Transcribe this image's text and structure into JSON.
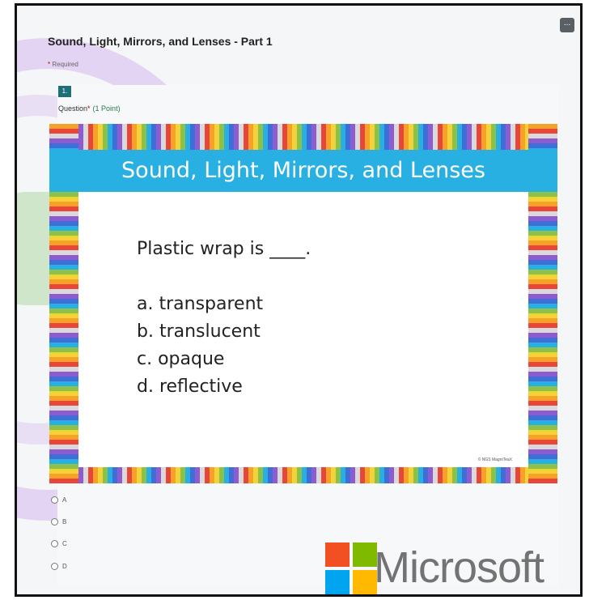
{
  "form": {
    "title": "Sound, Light, Mirrors, and Lenses - Part 1",
    "required_star": "*",
    "required_note": "Required",
    "more_icon": "..."
  },
  "question": {
    "number": "1.",
    "label": "Question",
    "required_star": "*",
    "points": "(1 Point)"
  },
  "slide": {
    "header": "Sound, Light, Mirrors, and Lenses",
    "stem": "Plastic wrap is ____.",
    "choices": [
      "a. transparent",
      "b. translucent",
      "c. opaque",
      "d. reflective"
    ],
    "copyright": "© NGS MagniTeaX"
  },
  "options": [
    "A",
    "B",
    "C",
    "D"
  ],
  "watermark": {
    "text": "Microsoft",
    "colors": [
      "#f25022",
      "#7fba00",
      "#00a4ef",
      "#ffb900"
    ]
  }
}
